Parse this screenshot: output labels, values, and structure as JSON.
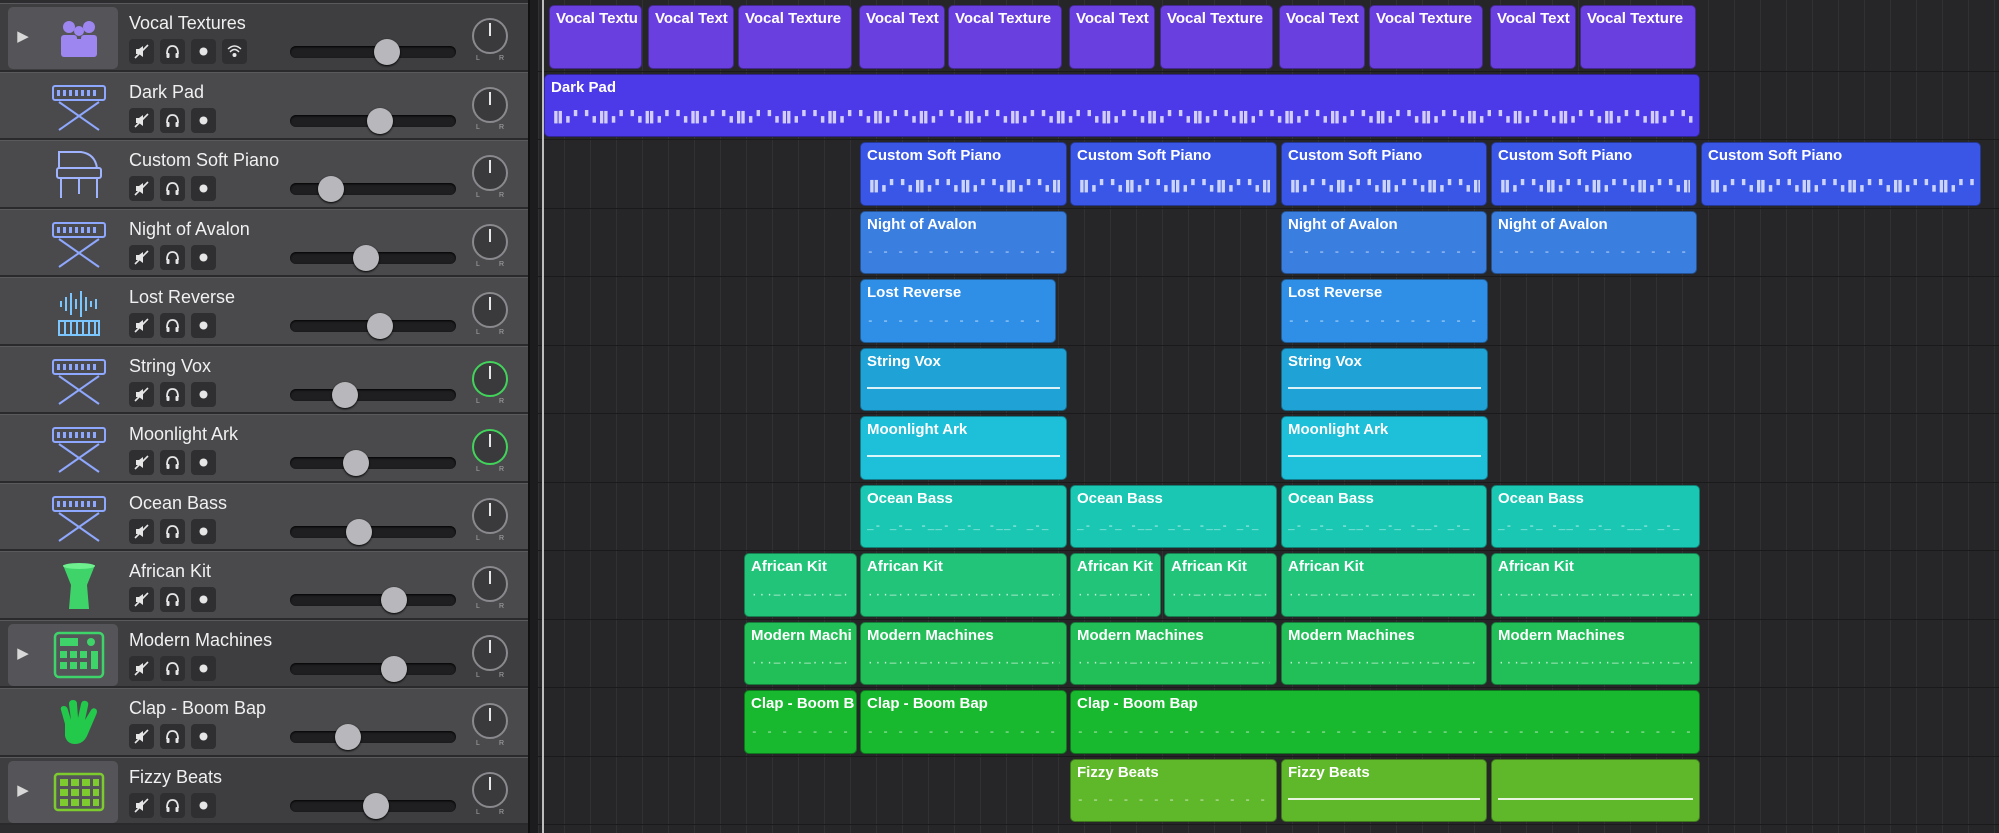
{
  "colors": {
    "vocal": "#6a3fe0",
    "darkpad": "#4c3ae8",
    "piano": "#3a56e6",
    "avalon": "#3a7fe0",
    "lost": "#2f8fe6",
    "string": "#1fa3d6",
    "moon": "#1ebfd8",
    "ocean": "#19c7b3",
    "african": "#22c47a",
    "modern": "#22bf58",
    "clap": "#18b82f",
    "fizzy": "#5fb82a"
  },
  "tracks": [
    {
      "name": "Vocal Textures",
      "icon": "choir-icon",
      "stack": true,
      "controls": [
        "mute",
        "headphones",
        "record",
        "input-monitor"
      ],
      "volume": 0.6,
      "pan_color": "normal"
    },
    {
      "name": "Dark Pad",
      "icon": "synth-keyboard-icon",
      "stack": false,
      "controls": [
        "mute",
        "headphones",
        "record"
      ],
      "volume": 0.55,
      "pan_color": "normal"
    },
    {
      "name": "Custom Soft Piano",
      "icon": "grand-piano-icon",
      "stack": false,
      "controls": [
        "mute",
        "headphones",
        "record"
      ],
      "volume": 0.2,
      "pan_color": "normal"
    },
    {
      "name": "Night of Avalon",
      "icon": "synth-keyboard-icon",
      "stack": false,
      "controls": [
        "mute",
        "headphones",
        "record"
      ],
      "volume": 0.45,
      "pan_color": "normal"
    },
    {
      "name": "Lost Reverse",
      "icon": "waveform-keyboard-icon",
      "stack": false,
      "controls": [
        "mute",
        "headphones",
        "record"
      ],
      "volume": 0.55,
      "pan_color": "normal"
    },
    {
      "name": "String Vox",
      "icon": "synth-keyboard-icon",
      "stack": false,
      "controls": [
        "mute",
        "headphones",
        "record"
      ],
      "volume": 0.3,
      "pan_color": "green"
    },
    {
      "name": "Moonlight Ark",
      "icon": "synth-keyboard-icon",
      "stack": false,
      "controls": [
        "mute",
        "headphones",
        "record"
      ],
      "volume": 0.38,
      "pan_color": "green"
    },
    {
      "name": "Ocean Bass",
      "icon": "synth-keyboard-icon",
      "stack": false,
      "controls": [
        "mute",
        "headphones",
        "record"
      ],
      "volume": 0.4,
      "pan_color": "normal"
    },
    {
      "name": "African Kit",
      "icon": "djembe-icon",
      "stack": false,
      "controls": [
        "mute",
        "headphones",
        "record"
      ],
      "volume": 0.65,
      "pan_color": "normal"
    },
    {
      "name": "Modern Machines",
      "icon": "drum-machine-icon",
      "stack": true,
      "controls": [
        "mute",
        "headphones",
        "record"
      ],
      "volume": 0.65,
      "pan_color": "normal"
    },
    {
      "name": "Clap - Boom Bap",
      "icon": "hand-clap-icon",
      "stack": false,
      "controls": [
        "mute",
        "headphones",
        "record"
      ],
      "volume": 0.32,
      "pan_color": "normal"
    },
    {
      "name": "Fizzy Beats",
      "icon": "beat-pads-icon",
      "stack": true,
      "controls": [
        "mute",
        "headphones",
        "record"
      ],
      "volume": 0.52,
      "pan_color": "normal"
    }
  ],
  "regions": [
    {
      "track": 0,
      "label": "Vocal Textu",
      "start": 549,
      "end": 642,
      "color": "vocal",
      "content": "none"
    },
    {
      "track": 0,
      "label": "Vocal Text",
      "start": 648,
      "end": 734,
      "color": "vocal",
      "content": "none"
    },
    {
      "track": 0,
      "label": "Vocal Texture",
      "start": 738,
      "end": 852,
      "color": "vocal",
      "content": "none"
    },
    {
      "track": 0,
      "label": "Vocal Text",
      "start": 859,
      "end": 945,
      "color": "vocal",
      "content": "none"
    },
    {
      "track": 0,
      "label": "Vocal Texture",
      "start": 948,
      "end": 1062,
      "color": "vocal",
      "content": "none"
    },
    {
      "track": 0,
      "label": "Vocal Text",
      "start": 1069,
      "end": 1155,
      "color": "vocal",
      "content": "none"
    },
    {
      "track": 0,
      "label": "Vocal Texture",
      "start": 1160,
      "end": 1273,
      "color": "vocal",
      "content": "none"
    },
    {
      "track": 0,
      "label": "Vocal Text",
      "start": 1279,
      "end": 1365,
      "color": "vocal",
      "content": "none"
    },
    {
      "track": 0,
      "label": "Vocal Texture",
      "start": 1369,
      "end": 1483,
      "color": "vocal",
      "content": "none"
    },
    {
      "track": 0,
      "label": "Vocal Text",
      "start": 1490,
      "end": 1576,
      "color": "vocal",
      "content": "none"
    },
    {
      "track": 0,
      "label": "Vocal Texture",
      "start": 1580,
      "end": 1696,
      "color": "vocal",
      "content": "none"
    },
    {
      "track": 1,
      "label": "Dark Pad",
      "start": 544,
      "end": 1700,
      "color": "darkpad",
      "content": "notes"
    },
    {
      "track": 2,
      "label": "Custom Soft Piano",
      "start": 860,
      "end": 1067,
      "color": "piano",
      "content": "notes"
    },
    {
      "track": 2,
      "label": "Custom Soft Piano",
      "start": 1070,
      "end": 1277,
      "color": "piano",
      "content": "notes"
    },
    {
      "track": 2,
      "label": "Custom Soft Piano",
      "start": 1281,
      "end": 1487,
      "color": "piano",
      "content": "notes"
    },
    {
      "track": 2,
      "label": "Custom Soft Piano",
      "start": 1491,
      "end": 1697,
      "color": "piano",
      "content": "notes"
    },
    {
      "track": 2,
      "label": "Custom Soft Piano",
      "start": 1701,
      "end": 1981,
      "color": "piano",
      "content": "notes"
    },
    {
      "track": 3,
      "label": "Night of Avalon",
      "start": 860,
      "end": 1067,
      "color": "avalon",
      "content": "dash"
    },
    {
      "track": 3,
      "label": "Night of Avalon",
      "start": 1281,
      "end": 1487,
      "color": "avalon",
      "content": "dash"
    },
    {
      "track": 3,
      "label": "Night of Avalon",
      "start": 1491,
      "end": 1697,
      "color": "avalon",
      "content": "dash"
    },
    {
      "track": 4,
      "label": "Lost Reverse",
      "start": 860,
      "end": 1056,
      "color": "lost",
      "content": "dash"
    },
    {
      "track": 4,
      "label": "Lost Reverse",
      "start": 1281,
      "end": 1488,
      "color": "lost",
      "content": "dash"
    },
    {
      "track": 5,
      "label": "String Vox",
      "start": 860,
      "end": 1067,
      "color": "string",
      "content": "line"
    },
    {
      "track": 5,
      "label": "String Vox",
      "start": 1281,
      "end": 1488,
      "color": "string",
      "content": "line"
    },
    {
      "track": 6,
      "label": "Moonlight Ark",
      "start": 860,
      "end": 1067,
      "color": "moon",
      "content": "line"
    },
    {
      "track": 6,
      "label": "Moonlight Ark",
      "start": 1281,
      "end": 1488,
      "color": "moon",
      "content": "line"
    },
    {
      "track": 7,
      "label": "Ocean Bass",
      "start": 860,
      "end": 1067,
      "color": "ocean",
      "content": "steps"
    },
    {
      "track": 7,
      "label": "Ocean Bass",
      "start": 1070,
      "end": 1277,
      "color": "ocean",
      "content": "steps"
    },
    {
      "track": 7,
      "label": "Ocean Bass",
      "start": 1281,
      "end": 1487,
      "color": "ocean",
      "content": "steps"
    },
    {
      "track": 7,
      "label": "Ocean Bass",
      "start": 1491,
      "end": 1700,
      "color": "ocean",
      "content": "steps"
    },
    {
      "track": 8,
      "label": "African Kit",
      "start": 744,
      "end": 857,
      "color": "african",
      "content": "dots"
    },
    {
      "track": 8,
      "label": "African Kit",
      "start": 860,
      "end": 1067,
      "color": "african",
      "content": "dots"
    },
    {
      "track": 8,
      "label": "African Kit",
      "start": 1070,
      "end": 1161,
      "color": "african",
      "content": "dots"
    },
    {
      "track": 8,
      "label": "African Kit",
      "start": 1164,
      "end": 1277,
      "color": "african",
      "content": "dots"
    },
    {
      "track": 8,
      "label": "African Kit",
      "start": 1281,
      "end": 1487,
      "color": "african",
      "content": "dots"
    },
    {
      "track": 8,
      "label": "African Kit",
      "start": 1491,
      "end": 1700,
      "color": "african",
      "content": "dots"
    },
    {
      "track": 9,
      "label": "Modern Machi",
      "start": 744,
      "end": 857,
      "color": "modern",
      "content": "dots"
    },
    {
      "track": 9,
      "label": "Modern Machines",
      "start": 860,
      "end": 1067,
      "color": "modern",
      "content": "dots"
    },
    {
      "track": 9,
      "label": "Modern Machines",
      "start": 1070,
      "end": 1277,
      "color": "modern",
      "content": "dots"
    },
    {
      "track": 9,
      "label": "Modern Machines",
      "start": 1281,
      "end": 1487,
      "color": "modern",
      "content": "dots"
    },
    {
      "track": 9,
      "label": "Modern Machines",
      "start": 1491,
      "end": 1700,
      "color": "modern",
      "content": "dots"
    },
    {
      "track": 10,
      "label": "Clap - Boom B",
      "start": 744,
      "end": 857,
      "color": "clap",
      "content": "dash"
    },
    {
      "track": 10,
      "label": "Clap - Boom Bap",
      "start": 860,
      "end": 1067,
      "color": "clap",
      "content": "dash"
    },
    {
      "track": 10,
      "label": "Clap - Boom Bap",
      "start": 1070,
      "end": 1700,
      "color": "clap",
      "content": "dash"
    },
    {
      "track": 11,
      "label": "Fizzy Beats",
      "start": 1070,
      "end": 1277,
      "color": "fizzy",
      "content": "dash"
    },
    {
      "track": 11,
      "label": "Fizzy Beats",
      "start": 1281,
      "end": 1487,
      "color": "fizzy",
      "content": "line"
    },
    {
      "track": 11,
      "label": "",
      "start": 1491,
      "end": 1700,
      "color": "fizzy",
      "content": "line"
    }
  ]
}
